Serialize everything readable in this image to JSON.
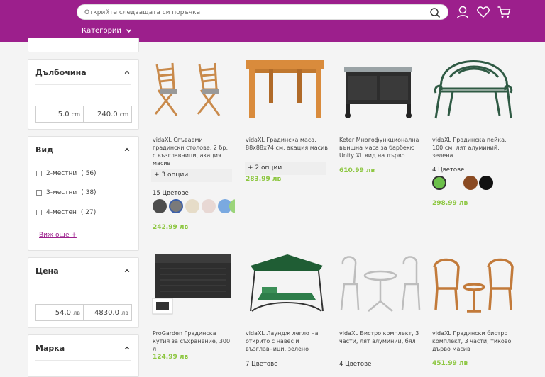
{
  "header": {
    "search_placeholder": "Открийте следващата си поръчка",
    "categories_label": "Категории",
    "icons": [
      "search-icon",
      "user-icon",
      "heart-icon",
      "cart-icon"
    ],
    "brand_color": "#9c1f8c"
  },
  "filters": {
    "depth": {
      "title": "Дълбочина",
      "min_value": "5.0",
      "max_value": "240.0",
      "unit": "cm"
    },
    "kind": {
      "title": "Вид",
      "options": [
        {
          "label": "2-местни",
          "count": "( 56)"
        },
        {
          "label": "3-местни",
          "count": "( 38)"
        },
        {
          "label": "4-местен",
          "count": "( 27)"
        }
      ],
      "see_more": "Виж още +"
    },
    "price": {
      "title": "Цена",
      "min_value": "54.0",
      "max_value": "4830.0",
      "unit": "лв"
    },
    "brand": {
      "title": "Марка"
    }
  },
  "products": [
    {
      "title": "vidaXL Сгъваеми градински столове, 2 бр, с възглавници, акация масив",
      "options": "+ 3 опции",
      "colors_label": "15 Цветове",
      "swatches": [
        "#4d4d4d",
        "#7a7a7a",
        "#e6dcc8",
        "#e8d8d4",
        "#7aa9e0",
        "#9bd47a"
      ],
      "price": "242.99 лв"
    },
    {
      "title": "vidaXL Градинска маса, 88x88x74 см, акация масив",
      "options": "+ 2 опции",
      "price": "283.99 лв"
    },
    {
      "title": "Keter Многофункционална външна маса за барбекю Unity XL вид на дърво",
      "price": "610.99 лв"
    },
    {
      "title": "vidaXL Градинска пейка, 100 см, лят алуминий, зелена",
      "colors_label": "4 Цветове",
      "swatches": [
        "#6cc04a",
        "#f4f4f4",
        "#8a4a22",
        "#111111"
      ],
      "price": "298.99 лв"
    },
    {
      "title": "ProGarden Градинска кутия за съхранение, 300 л",
      "price": "124.99 лв"
    },
    {
      "title": "vidaXL Лаундж легло на открито с навес и възглавници, зелено",
      "colors_label": "7 Цветове"
    },
    {
      "title": "vidaXL Бистро комплект, 3 части, лят алуминий, бял",
      "colors_label": "4 Цветове"
    },
    {
      "title": "vidaXL Градински бистро комплект, 3 части, тиково дърво масив",
      "price": "451.99 лв"
    }
  ]
}
